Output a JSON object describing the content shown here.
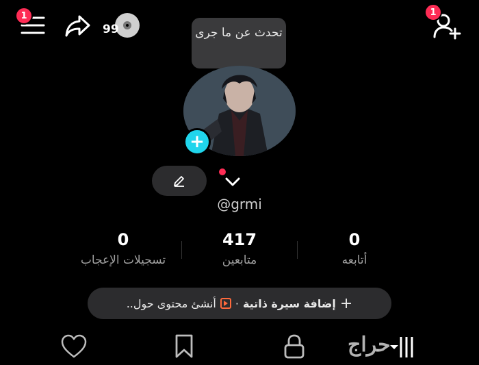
{
  "header": {
    "menu_badge": "1",
    "share_count": "99",
    "friends_badge": "1"
  },
  "tooltip": {
    "text": "تحدث عن ما جرى"
  },
  "profile": {
    "username": "@grmi"
  },
  "stats": [
    {
      "value": "0",
      "label": "تسجيلات الإعجاب"
    },
    {
      "value": "417",
      "label": "متابعين"
    },
    {
      "value": "0",
      "label": "أتابعه"
    }
  ],
  "bio_bar": {
    "add_bio": "إضافة سيرة ذاتية",
    "separator": "·",
    "create_content": "أنشئ محتوى حول..",
    "plus": "+"
  },
  "tabs": [
    "liked-tab",
    "favorites-tab",
    "private-tab",
    "videos-tab"
  ],
  "watermark": "حراج",
  "colors": {
    "accent": "#20d5ec",
    "badge": "#fe2c55",
    "play": "#ff6a3c"
  }
}
